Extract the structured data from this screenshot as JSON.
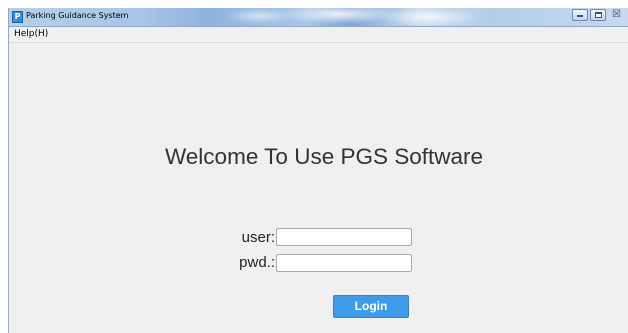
{
  "window": {
    "title": "Parking Guidance System",
    "app_icon_letter": "P",
    "controls": {
      "minimize": "minimize-icon",
      "maximize": "maximize-icon",
      "close": "close-icon",
      "close_glyph": "☒"
    }
  },
  "menubar": {
    "items": [
      {
        "label": "Help(H)"
      }
    ]
  },
  "main": {
    "welcome_text": "Welcome To Use PGS Software",
    "login_form": {
      "user_label": "user:",
      "user_value": "",
      "pwd_label": "pwd.:",
      "pwd_value": "",
      "login_label": "Login"
    }
  },
  "colors": {
    "window_background": "#f0f0f0",
    "login_button": "#3d9be9",
    "welcome_text": "#333333"
  }
}
